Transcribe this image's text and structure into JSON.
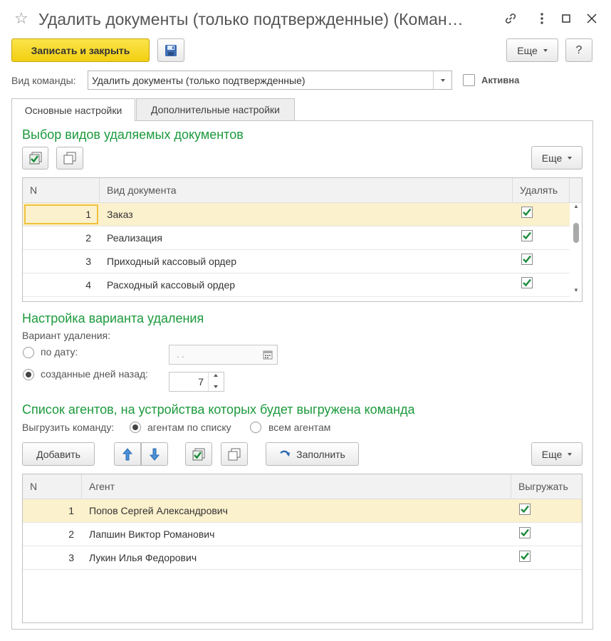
{
  "window": {
    "title": "Удалить документы (только подтвержденные) (Коман…",
    "star_icon": "star-icon",
    "link_icon": "link-icon",
    "more_icon": "more-vertical-icon",
    "maximize_icon": "maximize-icon",
    "close_icon": "close-icon"
  },
  "toolbar": {
    "save_close_label": "Записать и закрыть",
    "save_icon": "floppy-disk-icon",
    "more_label": "Еще",
    "help_label": "?"
  },
  "command": {
    "type_label": "Вид команды:",
    "type_value": "Удалить документы (только подтвержденные)",
    "active_label": "Активна",
    "active_checked": false
  },
  "tabs": [
    {
      "label": "Основные настройки",
      "active": true
    },
    {
      "label": "Дополнительные настройки",
      "active": false
    }
  ],
  "doc_section": {
    "title": "Выбор видов удаляемых документов",
    "more_label": "Еще",
    "columns": {
      "n": "N",
      "doc": "Вид документа",
      "delete": "Удалять"
    },
    "rows": [
      {
        "n": "1",
        "doc": "Заказ",
        "checked": true
      },
      {
        "n": "2",
        "doc": "Реализация",
        "checked": true
      },
      {
        "n": "3",
        "doc": "Приходный кассовый ордер",
        "checked": true
      },
      {
        "n": "4",
        "doc": "Расходный кассовый ордер",
        "checked": true
      }
    ]
  },
  "deletion": {
    "title": "Настройка варианта удаления",
    "variant_label": "Вариант удаления:",
    "by_date_label": "по дату:",
    "by_date_value": ". .",
    "days_ago_label": "созданные дней назад:",
    "days_ago_value": "7",
    "selected": "days_ago"
  },
  "agents_section": {
    "title": "Список агентов, на устройства которых будет выгружена команда",
    "upload_label": "Выгрузить команду:",
    "by_list_label": "агентам по списку",
    "all_label": "всем агентам",
    "selected": "by_list",
    "add_label": "Добавить",
    "fill_label": "Заполнить",
    "more_label": "Еще",
    "columns": {
      "n": "N",
      "agent": "Агент",
      "upload": "Выгружать"
    },
    "rows": [
      {
        "n": "1",
        "agent": "Попов Сергей Александрович",
        "checked": true
      },
      {
        "n": "2",
        "agent": "Лапшин Виктор Романович",
        "checked": true
      },
      {
        "n": "3",
        "agent": "Лукин Илья Федорович",
        "checked": true
      }
    ]
  },
  "colors": {
    "accent_green": "#1c9a3c",
    "primary_button": "#f5d516",
    "selected_row": "#fbf1cd",
    "check_green": "#1a8a3a"
  }
}
